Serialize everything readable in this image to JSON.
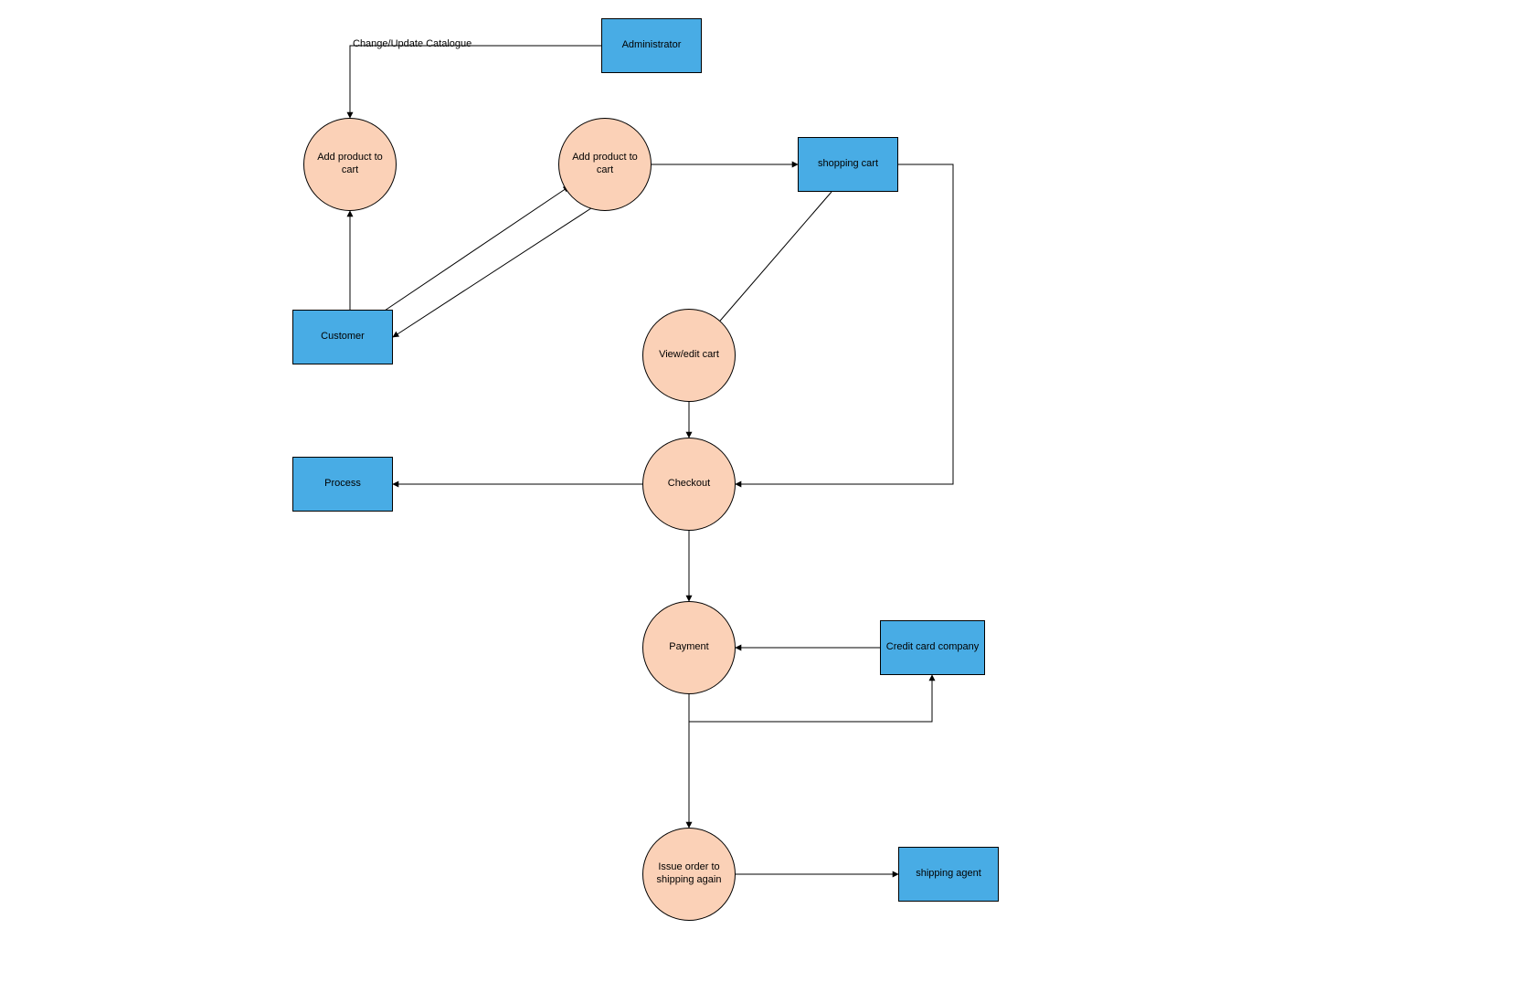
{
  "nodes": {
    "administrator": {
      "label": "Administrator"
    },
    "customer": {
      "label": "Customer"
    },
    "shoppingCart": {
      "label": "shopping cart"
    },
    "process": {
      "label": "Process"
    },
    "creditCardCompany": {
      "label": "Credit card company"
    },
    "shippingAgent": {
      "label": "shipping agent"
    },
    "addProduct1": {
      "label": "Add product to cart"
    },
    "addProduct2": {
      "label": "Add product to cart"
    },
    "viewEditCart": {
      "label": "View/edit cart"
    },
    "checkout": {
      "label": "Checkout"
    },
    "payment": {
      "label": "Payment"
    },
    "issueOrder": {
      "label": "Issue order to shipping again"
    }
  },
  "edges": {
    "changeCatalogue": {
      "label": "Change/Update Catalogue"
    }
  },
  "colors": {
    "rect": "#48ace5",
    "circle": "#fbd1b7"
  }
}
